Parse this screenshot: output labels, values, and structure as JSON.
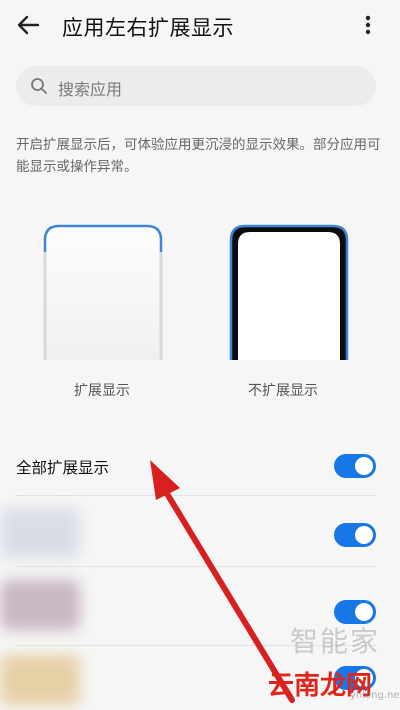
{
  "header": {
    "title": "应用左右扩展显示",
    "back_icon": "back-arrow-icon",
    "more_icon": "more-vertical-icon"
  },
  "search": {
    "placeholder": "搜索应用",
    "icon": "search-icon"
  },
  "description": "开启扩展显示后，可体验应用更沉浸的显示效果。部分应用可能显示或操作异常。",
  "previews": {
    "extended_label": "扩展显示",
    "not_extended_label": "不扩展显示"
  },
  "list": {
    "all_label": "全部扩展显示",
    "toggles": [
      true,
      true,
      true,
      true
    ]
  },
  "watermark": {
    "line1": "智能家",
    "line2": "云南龙网",
    "line3": "ynlong.net"
  },
  "colors": {
    "accent": "#1677e6",
    "annotation_arrow": "#d82020"
  }
}
